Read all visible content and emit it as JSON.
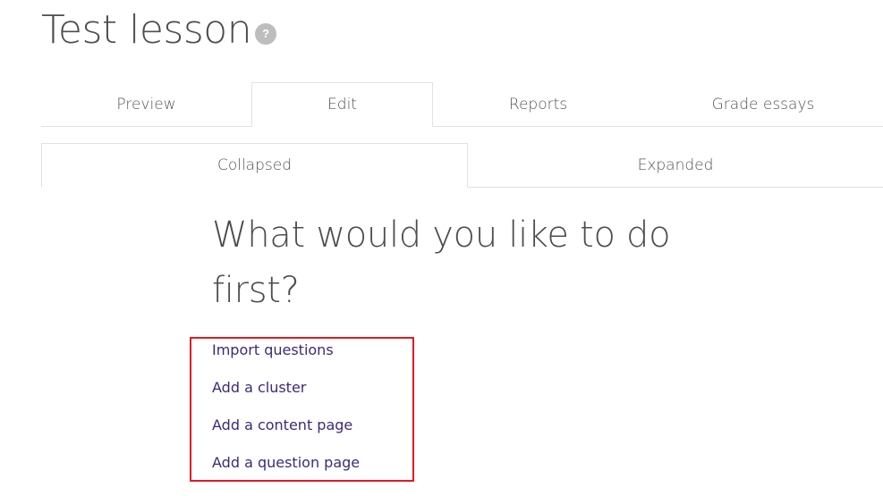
{
  "page": {
    "title": "Test lesson",
    "help_icon_glyph": "?"
  },
  "tabs_primary": [
    {
      "label": "Preview",
      "active": false
    },
    {
      "label": "Edit",
      "active": true
    },
    {
      "label": "Reports",
      "active": false
    },
    {
      "label": "Grade essays",
      "active": false
    }
  ],
  "tabs_secondary": [
    {
      "label": "Collapsed",
      "active": true
    },
    {
      "label": "Expanded",
      "active": false
    }
  ],
  "prompt": {
    "heading": "What would you like to do first?"
  },
  "actions": [
    {
      "label": "Import questions"
    },
    {
      "label": "Add a cluster"
    },
    {
      "label": "Add a content page"
    },
    {
      "label": "Add a question page"
    }
  ],
  "colors": {
    "link": "#3c2a7a",
    "highlight_border": "#e01b24"
  }
}
